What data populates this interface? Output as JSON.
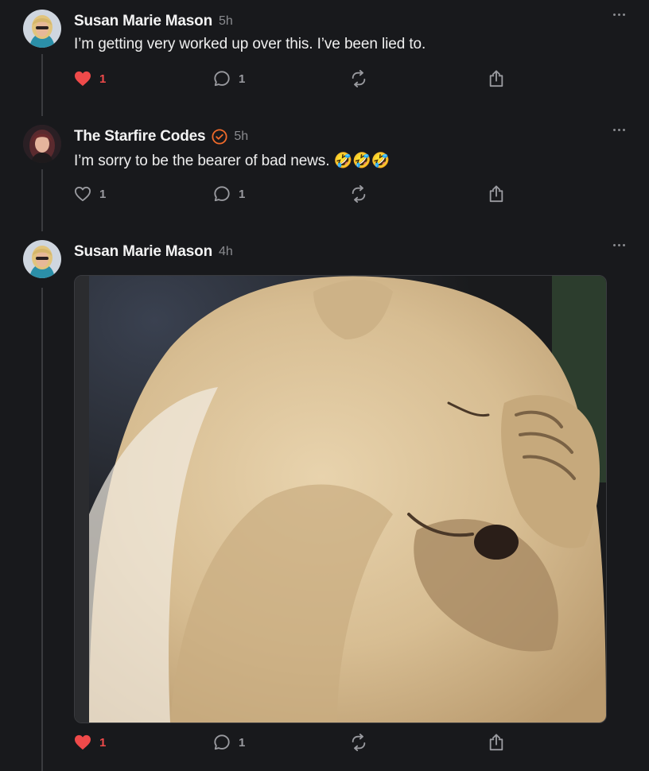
{
  "posts": [
    {
      "author": "Susan Marie Mason",
      "time": "5h",
      "text": "I’m getting very worked up over this. I’ve been lied to.",
      "likes": "1",
      "comments": "1",
      "liked": true
    },
    {
      "author": "The Starfire Codes",
      "time": "5h",
      "text": "I’m sorry to be the bearer of bad news. 🤣🤣🤣",
      "likes": "1",
      "comments": "1",
      "liked": false,
      "verified": true
    },
    {
      "author": "Susan Marie Mason",
      "time": "4h",
      "text": "",
      "likes": "1",
      "comments": "1",
      "liked": true,
      "image": "polar-bear-cub-facepalm"
    }
  ],
  "colors": {
    "background": "#18191c",
    "liked": "#ef4a4a",
    "verified": "#f06a2a",
    "muted": "#8a8b8f"
  },
  "icons": [
    "heart-icon",
    "comment-icon",
    "repost-icon",
    "share-icon",
    "more-icon",
    "verified-badge-icon"
  ]
}
